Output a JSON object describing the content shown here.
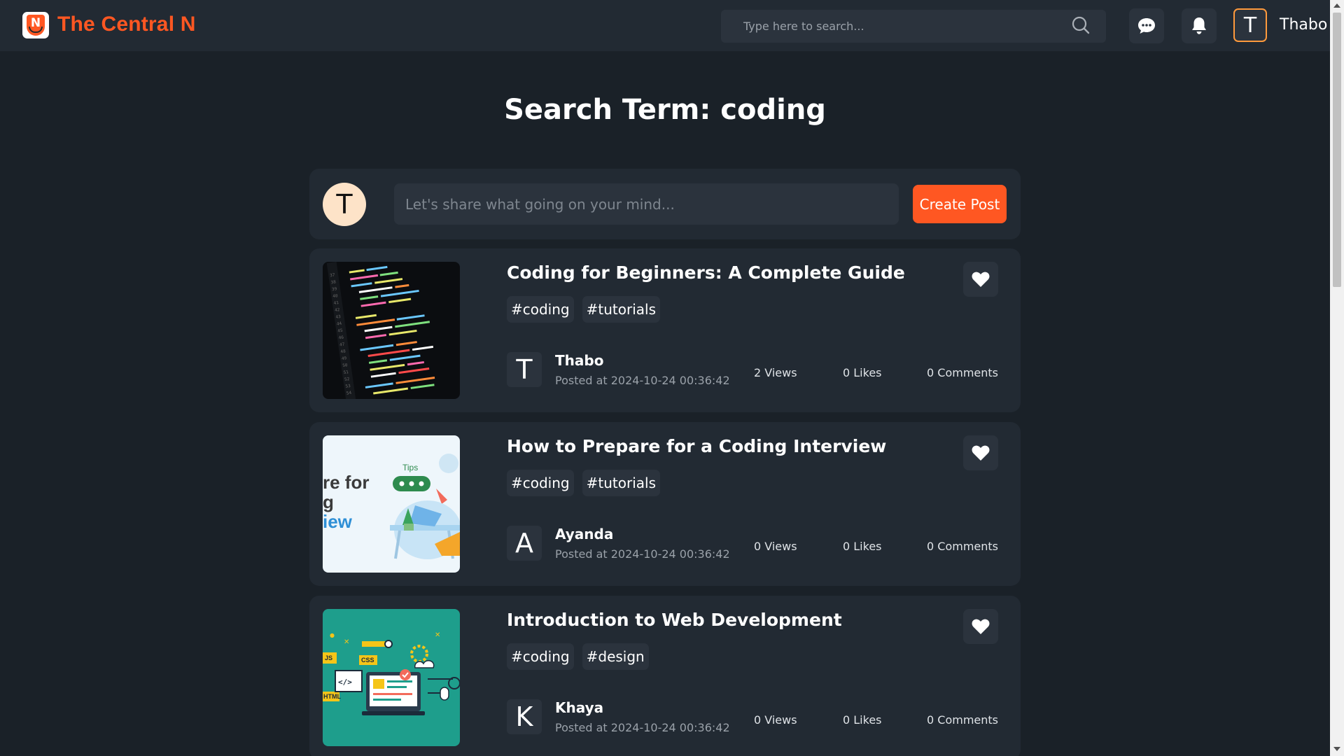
{
  "header": {
    "brand": "The Central N",
    "logo_letter": "N",
    "search_placeholder": "Type here to search...",
    "user_initial": "T",
    "username": "Thabo"
  },
  "page": {
    "title": "Search Term: coding"
  },
  "composer": {
    "avatar_initial": "T",
    "placeholder": "Let's share what going on your mind...",
    "create_button": "Create Post"
  },
  "posts": [
    {
      "title": "Coding for Beginners: A Complete Guide",
      "tags": [
        "#coding",
        "#tutorials"
      ],
      "author_initial": "T",
      "author": "Thabo",
      "posted_at": "Posted at 2024-10-24 00:36:42",
      "views": "2 Views",
      "likes": "0 Likes",
      "comments": "0 Comments"
    },
    {
      "title": "How to Prepare for a Coding Interview",
      "tags": [
        "#coding",
        "#tutorials"
      ],
      "author_initial": "A",
      "author": "Ayanda",
      "posted_at": "Posted at 2024-10-24 00:36:42",
      "views": "0 Views",
      "likes": "0 Likes",
      "comments": "0 Comments",
      "thumb_text": [
        "re for",
        "g",
        "iew"
      ],
      "thumb_badge": "Tips"
    },
    {
      "title": "Introduction to Web Development",
      "tags": [
        "#coding",
        "#design"
      ],
      "author_initial": "K",
      "author": "Khaya",
      "posted_at": "Posted at 2024-10-24 00:36:42",
      "views": "0 Views",
      "likes": "0 Likes",
      "comments": "0 Comments",
      "thumb_labels": [
        "JS",
        "CSS",
        "HTML",
        "</>"
      ]
    }
  ],
  "colors": {
    "background": "#1a2128",
    "surface": "#222a33",
    "control": "#2b333d",
    "accent": "#ff5722",
    "avatar_border": "#ff9a3c"
  },
  "icons": {
    "search": "search-icon",
    "messages": "chat-icon",
    "notifications": "bell-icon",
    "like": "heart-icon"
  }
}
